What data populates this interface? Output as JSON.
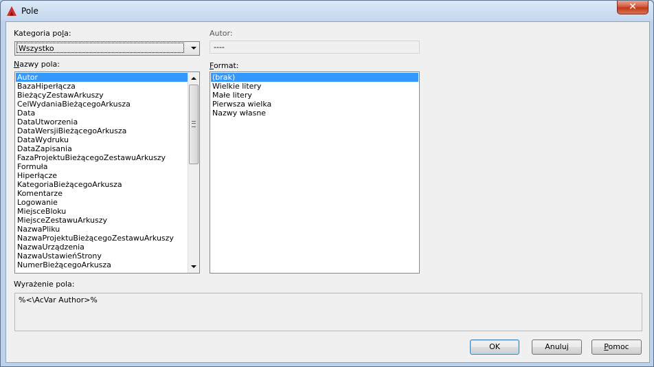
{
  "window": {
    "title": "Pole",
    "close_label": "✕"
  },
  "category": {
    "label_pre": "Kategoria po",
    "label_u": "l",
    "label_post": "a:",
    "value": "Wszystko"
  },
  "author": {
    "label": "Autor:",
    "value": "----"
  },
  "fields": {
    "label_u": "N",
    "label_post": "azwy pola:",
    "items": [
      "Autor",
      "BazaHiperłącza",
      "BieżącyZestawArkuszy",
      "CelWydaniaBieżącegoArkusza",
      "Data",
      "DataUtworzenia",
      "DataWersjiBieżącegoArkusza",
      "DataWydruku",
      "DataZapisania",
      "FazaProjektuBieżącegoZestawuArkuszy",
      "Formuła",
      "Hiperłącze",
      "KategoriaBieżącegoArkusza",
      "Komentarze",
      "Logowanie",
      "MiejsceBloku",
      "MiejsceZestawuArkuszy",
      "NazwaPliku",
      "NazwaProjektuBieżącegoZestawuArkuszy",
      "NazwaUrządzenia",
      "NazwaUstawieńStrony",
      "NumerBieżącegoArkusza"
    ],
    "selected": "Autor"
  },
  "format": {
    "label_u": "F",
    "label_post": "ormat:",
    "items": [
      "(brak)",
      "Wielkie litery",
      "Małe litery",
      "Pierwsza wielka",
      "Nazwy własne"
    ],
    "selected": "(brak)"
  },
  "expression": {
    "label": "Wyrażenie pola:",
    "value": "%<\\AcVar Author>%"
  },
  "buttons": {
    "ok": "OK",
    "cancel": "Anuluj",
    "help_u": "P",
    "help_post": "omoc"
  },
  "colors": {
    "selection": "#3399ff",
    "title_bar": "#c5d8ee",
    "close_button": "#c2381b"
  },
  "icons": {
    "app": "autocad-a-icon"
  }
}
